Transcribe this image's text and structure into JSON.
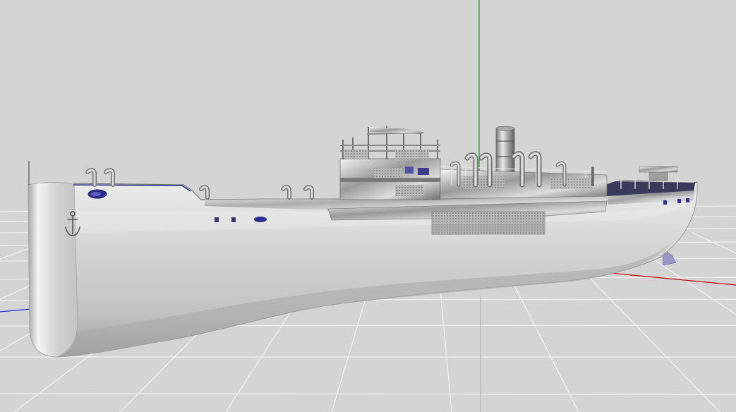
{
  "viewport": {
    "background": "#d4d4d4",
    "grid_color": "#f2f2f2",
    "axis_x_color": "#cc0000",
    "axis_y_color": "#00aa00",
    "axis_z_color": "#2a2ad8"
  },
  "model": {
    "hull_color": "#c9c9c9",
    "hull_highlight": "#efefef",
    "hull_shadow": "#8f8f8f",
    "accent_color": "#2e2e8c",
    "icons": [
      "anchor-icon"
    ]
  }
}
